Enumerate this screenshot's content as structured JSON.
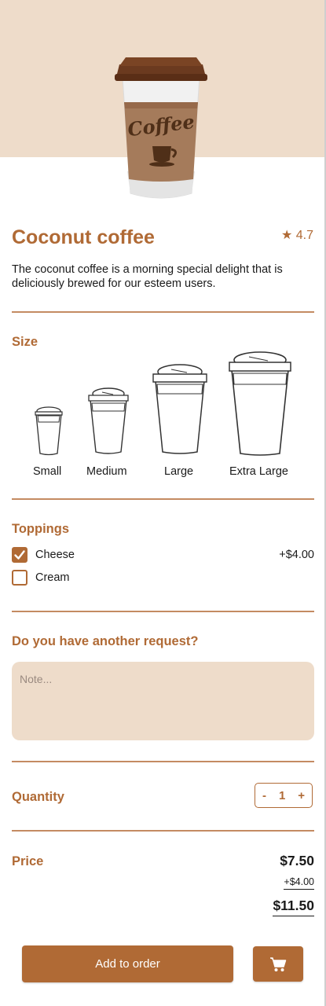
{
  "product": {
    "name": "Coconut coffee",
    "rating": "★ 4.7",
    "description": "The coconut coffee is a morning special delight that is deliciously brewed for our esteem users.",
    "image_text": "Coffee",
    "hero_background": "#eedcca",
    "accent_color": "#b06a35"
  },
  "size": {
    "label": "Size",
    "options": [
      "Small",
      "Medium",
      "Large",
      "Extra Large"
    ]
  },
  "toppings": {
    "label": "Toppings",
    "items": [
      {
        "name": "Cheese",
        "checked": true,
        "price": "+$4.00"
      },
      {
        "name": "Cream",
        "checked": false,
        "price": ""
      }
    ]
  },
  "request": {
    "label": "Do you have another request?",
    "placeholder": "Note..."
  },
  "quantity": {
    "label": "Quantity",
    "minus": "-",
    "value": "1",
    "plus": "+"
  },
  "price": {
    "label": "Price",
    "base": "$7.50",
    "extra": "+$4.00",
    "total": "$11.50"
  },
  "actions": {
    "add_label": "Add to order",
    "cart_icon": "cart-icon"
  }
}
